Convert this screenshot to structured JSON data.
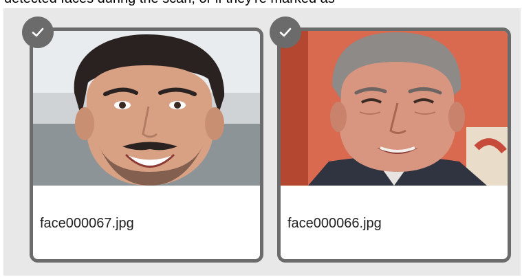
{
  "caption": "detected faces during the scan, or if they're marked as",
  "gallery": {
    "items": [
      {
        "filename": "face000067.jpg",
        "selected": true,
        "icon": "check-icon"
      },
      {
        "filename": "face000066.jpg",
        "selected": true,
        "icon": "check-icon"
      }
    ]
  },
  "colors": {
    "panel_bg": "#e8e8e8",
    "card_border": "#6b6b6b",
    "badge_bg": "#6b6b6b",
    "check_color": "#ffffff"
  }
}
